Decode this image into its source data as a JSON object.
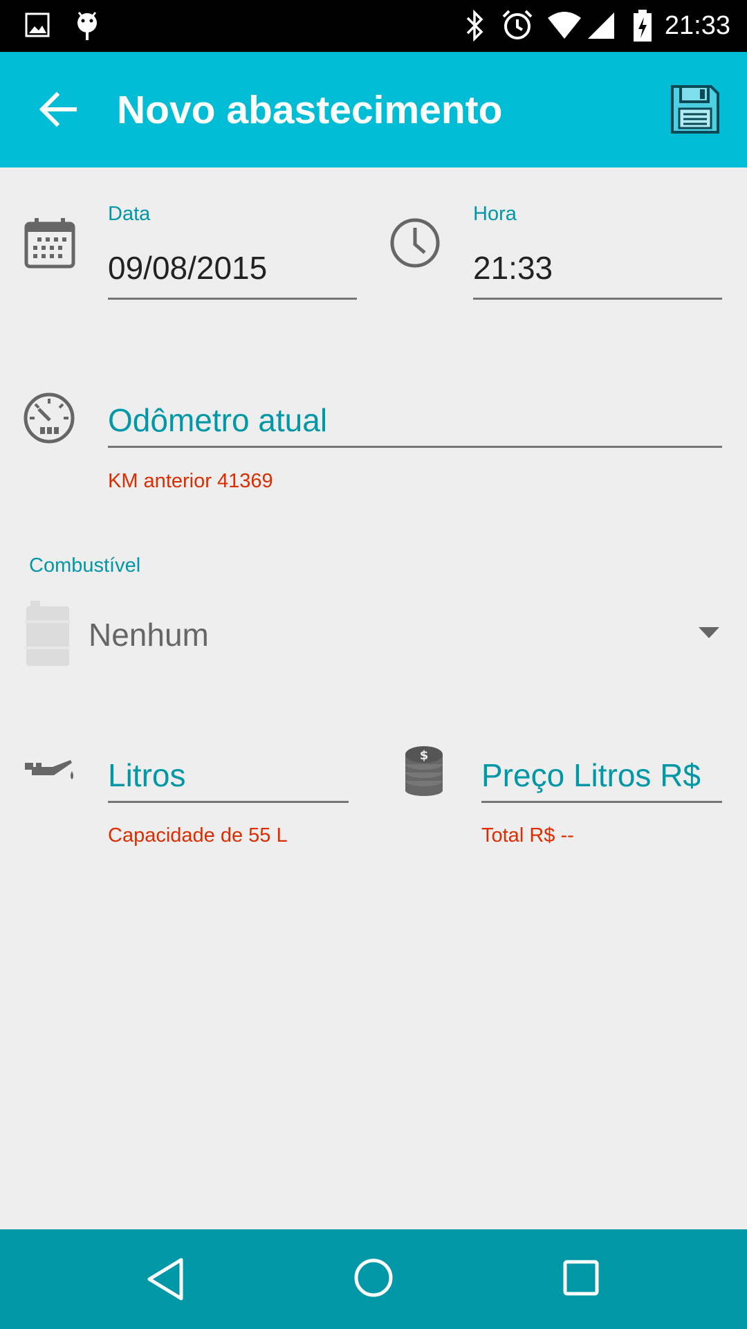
{
  "status_bar": {
    "time": "21:33"
  },
  "app_bar": {
    "title": "Novo abastecimento"
  },
  "form": {
    "date": {
      "label": "Data",
      "value": "09/08/2015"
    },
    "time": {
      "label": "Hora",
      "value": "21:33"
    },
    "odometer": {
      "placeholder": "Odômetro atual",
      "helper": "KM anterior 41369"
    },
    "fuel": {
      "label": "Combustível",
      "selected": "Nenhum"
    },
    "liters": {
      "placeholder": "Litros",
      "helper": "Capacidade de 55 L"
    },
    "price": {
      "placeholder": "Preço Litros R$",
      "helper": "Total R$ --"
    }
  },
  "icons": {
    "status_left": [
      "image-icon",
      "android-debug-icon"
    ],
    "status_right": [
      "bluetooth-icon",
      "alarm-icon",
      "wifi-icon",
      "signal-icon",
      "battery-charging-icon"
    ],
    "app_bar": [
      "back-arrow-icon",
      "save-icon"
    ],
    "nav": [
      "nav-back-icon",
      "nav-home-icon",
      "nav-recents-icon"
    ]
  },
  "colors": {
    "app_bar": "#00bcd4",
    "accent": "#0097a7",
    "error": "#dd2c00",
    "nav_bar": "#0097a7",
    "background": "#eeeeee"
  }
}
